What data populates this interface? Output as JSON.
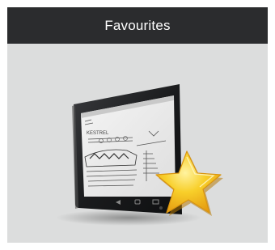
{
  "header": {
    "title": "Favourites"
  },
  "illustration": {
    "icon": "tablet-with-star-icon",
    "screen_label": "KESTREL",
    "colors": {
      "background": "#dcdddd",
      "header": "#2b2c2e",
      "tablet_bezel": "#1c1d1f",
      "screen": "#eeeeee",
      "star_fill": "#f6c21d",
      "star_edge": "#d9940f"
    }
  }
}
